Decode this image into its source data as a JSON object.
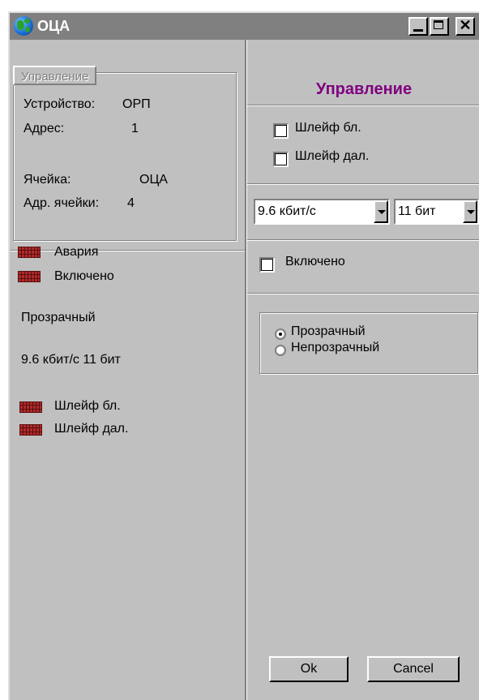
{
  "window": {
    "title": "ОЦА"
  },
  "left": {
    "group_tab_label": "Управление",
    "info": {
      "device_label": "Устройство:",
      "device_value": "ОРП",
      "address_label": "Адрес:",
      "address_value": "1",
      "cell_label": "Ячейка:",
      "cell_value": "ОЦА",
      "cell_address_label": "Адр. ячейки:",
      "cell_address_value": "4"
    },
    "indicators": [
      {
        "label": "Авария"
      },
      {
        "label": "Включено"
      }
    ],
    "mode_text": "Прозрачный",
    "speed_text": "9.6 кбит/с 11 бит",
    "loop_indicators": [
      {
        "label": "Шлейф бл."
      },
      {
        "label": "Шлейф дал."
      }
    ]
  },
  "right": {
    "title": "Управление",
    "checkboxes": [
      {
        "label": "Шлейф бл.",
        "checked": false
      },
      {
        "label": "Шлейф дал.",
        "checked": false
      }
    ],
    "speed_select": {
      "value": "9.6  кбит/с"
    },
    "bits_select": {
      "value": "11 бит"
    },
    "enabled_checkbox": {
      "label": "Включено",
      "checked": false
    },
    "radios": [
      {
        "label": "Прозрачный",
        "selected": true
      },
      {
        "label": "Непрозрачный",
        "selected": false
      }
    ],
    "ok_label": "Ok",
    "cancel_label": "Cancel"
  },
  "colors": {
    "title_accent": "#800080",
    "indicator_red": "#b02a2a",
    "face": "#c0c0c0",
    "titlebar": "#808080"
  },
  "icons": {
    "app": "globe-icon",
    "minimize": "minimize-icon",
    "maximize": "maximize-icon",
    "close": "close-icon"
  }
}
